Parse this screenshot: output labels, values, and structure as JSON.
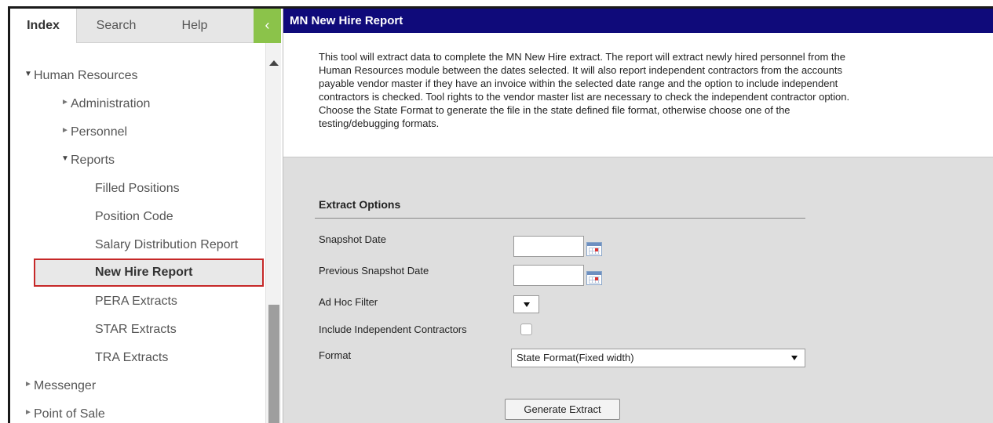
{
  "left_panel": {
    "tabs": [
      {
        "label": "Index",
        "active": true
      },
      {
        "label": "Search",
        "active": false
      },
      {
        "label": "Help",
        "active": false
      }
    ],
    "collapse_glyph": "‹",
    "collapse_icon": "chevron-left-icon",
    "tree": {
      "human_resources": "Human Resources",
      "administration": "Administration",
      "personnel": "Personnel",
      "reports": "Reports",
      "report_items": [
        "Filled Positions",
        "Position Code",
        "Salary Distribution Report",
        "New Hire Report",
        "PERA Extracts",
        "STAR Extracts",
        "TRA Extracts"
      ],
      "selected": "New Hire Report",
      "messenger": "Messenger",
      "point_of_sale": "Point of Sale"
    },
    "glyphs": {
      "expanded": "▼",
      "collapsed": "►"
    }
  },
  "main": {
    "title": "MN New Hire Report",
    "description_lines": [
      "This tool will extract data to complete the MN New Hire extract. The report will extract newly hired personnel from the",
      "Human Resources module between the dates selected. It will also report independent contractors from the accounts",
      "payable vendor master if they have an invoice within the selected date range and the option to include independent",
      "contractors is checked. Tool rights to the vendor master list are necessary to check the independent contractor option.",
      "Choose the State Format to generate the file in the state defined file format, otherwise choose one of the",
      "testing/debugging formats."
    ],
    "extract_options": {
      "heading": "Extract Options",
      "snapshot_date_label": "Snapshot Date",
      "snapshot_date_value": "",
      "previous_snapshot_date_label": "Previous Snapshot Date",
      "previous_snapshot_date_value": "",
      "ad_hoc_filter_label": "Ad Hoc Filter",
      "ad_hoc_filter_value": "",
      "include_contractors_label": "Include Independent Contractors",
      "include_contractors_checked": false,
      "format_label": "Format",
      "format_value": "State Format(Fixed width)",
      "generate_button": "Generate Extract"
    }
  },
  "colors": {
    "title_bar": "#0f0a7a",
    "collapse_button": "#8bc34a",
    "selected_outline": "#c62828",
    "options_bg": "#dedede"
  }
}
